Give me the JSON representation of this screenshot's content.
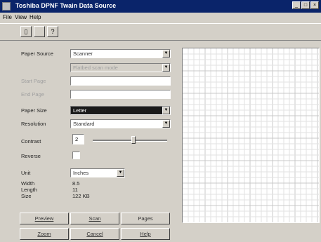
{
  "window": {
    "title": "Toshiba DPNF Twain Data Source"
  },
  "title_controls": {
    "minimize": "_",
    "maximize": "□",
    "close": "×"
  },
  "menu": [
    "File",
    "View",
    "Help"
  ],
  "toolbar": {
    "tools": [
      "open-doc-icon",
      "blank-icon",
      "help-icon"
    ],
    "tool_glyphs": [
      "▯",
      "",
      "?"
    ]
  },
  "form": {
    "paper_source": {
      "label": "Paper Source",
      "value": "Scanner"
    },
    "disabled_combo": {
      "value": "Flatbed scan mode"
    },
    "disabled_field_1": {
      "label": "Start Page",
      "value": ""
    },
    "disabled_field_2": {
      "label": "End Page",
      "value": ""
    },
    "paper_size": {
      "label": "Paper Size",
      "value": "Letter"
    },
    "resolution": {
      "label": "Resolution",
      "value": "Standard"
    },
    "contrast": {
      "label": "Contrast",
      "value": "2",
      "level": 0.55
    },
    "reverse": {
      "label": "Reverse",
      "checked": false
    },
    "unit": {
      "label": "Unit",
      "value": "Inches"
    },
    "width": {
      "label": "Width",
      "value": "8.5"
    },
    "length": {
      "label": "Length",
      "value": "11"
    },
    "size": {
      "label": "Size",
      "value": "122 KB"
    }
  },
  "buttons": {
    "preview": "Preview",
    "scan": "Scan",
    "pages": "Pages",
    "zoom": "Zoom",
    "cancel": "Cancel",
    "help": "Help"
  }
}
